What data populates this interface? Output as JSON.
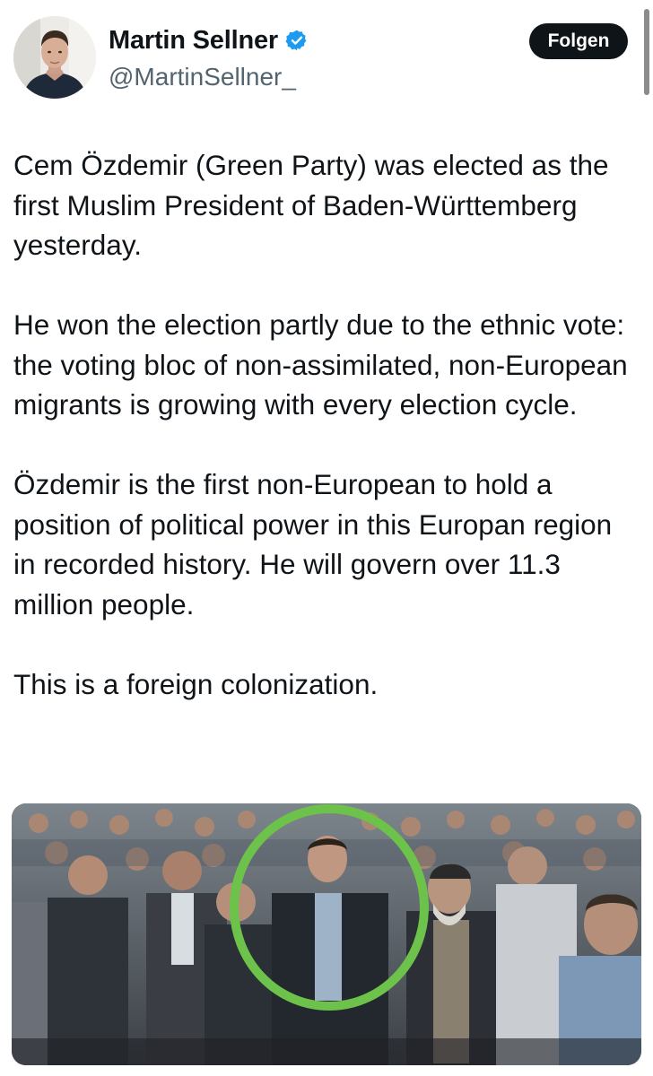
{
  "author": {
    "display_name": "Martin Sellner",
    "handle": "@MartinSellner_",
    "avatar_icon": "profile-photo",
    "verified_icon": "verified-badge-icon",
    "verified_color": "#1d9bf0"
  },
  "follow_button": {
    "label": "Folgen",
    "background": "#0f1419",
    "text_color": "#ffffff"
  },
  "tweet": {
    "paragraphs": [
      "Cem Özdemir (Green Party) was elected as the first Muslim President of Baden-Württemberg yesterday.",
      "He won the election partly due to the ethnic vote: the voting bloc of non-assimilated, non-European migrants is growing with every election cycle.",
      "Özdemir is the first non-European to hold a position of political power in this Europan region in recorded history. He will govern over 11.3 million people.",
      "This is a  foreign colonization."
    ]
  },
  "media": {
    "type": "photo",
    "description_icon": "crowd-photo",
    "highlight_color": "#6cc24a"
  }
}
